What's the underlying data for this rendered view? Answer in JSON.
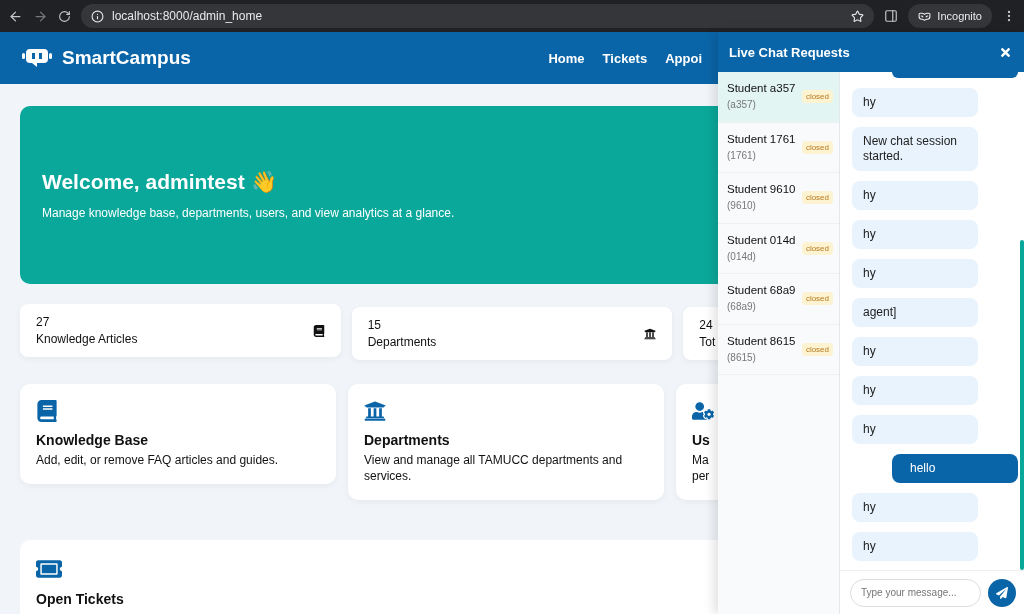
{
  "browser": {
    "url": "localhost:8000/admin_home",
    "profile": "Incognito"
  },
  "header": {
    "brand": "SmartCampus",
    "nav": [
      {
        "label": "Home"
      },
      {
        "label": "Tickets"
      },
      {
        "label": "Appoi"
      }
    ]
  },
  "hero": {
    "title": "Welcome, admintest 👋",
    "subtitle": "Manage knowledge base, departments, users, and view analytics at a glance."
  },
  "stats": [
    {
      "kind": "book",
      "value": "27",
      "label": "Knowledge Articles"
    },
    {
      "kind": "building",
      "value": "15",
      "label": "Departments"
    },
    {
      "kind": "hidden",
      "value": "24",
      "label": "Tot"
    }
  ],
  "features": [
    {
      "kind": "book",
      "title": "Knowledge Base",
      "description": "Add, edit, or remove FAQ articles and guides."
    },
    {
      "kind": "building",
      "title": "Departments",
      "description": "View and manage all TAMUCC departments and services."
    },
    {
      "kind": "user",
      "title": "Us",
      "description": "Ma\nper"
    }
  ],
  "tickets_card": {
    "title": "Open Tickets"
  },
  "chat": {
    "title": "Live Chat Requests",
    "requests": [
      {
        "name": "Student a357",
        "id": "(a357)",
        "status": "closed",
        "selected": true
      },
      {
        "name": "Student 1761",
        "id": "(1761)",
        "status": "closed",
        "selected": false
      },
      {
        "name": "Student 9610",
        "id": "(9610)",
        "status": "closed",
        "selected": false
      },
      {
        "name": "Student 014d",
        "id": "(014d)",
        "status": "closed",
        "selected": false
      },
      {
        "name": "Student 68a9",
        "id": "(68a9)",
        "status": "closed",
        "selected": false
      },
      {
        "name": "Student 8615",
        "id": "(8615)",
        "status": "closed",
        "selected": false
      }
    ],
    "messages": [
      {
        "kind": "received",
        "text": "hy"
      },
      {
        "kind": "received",
        "text": "New chat session started."
      },
      {
        "kind": "received",
        "text": "hy"
      },
      {
        "kind": "received",
        "text": "hy"
      },
      {
        "kind": "received",
        "text": "hy"
      },
      {
        "kind": "received",
        "text": "agent]"
      },
      {
        "kind": "received",
        "text": "hy"
      },
      {
        "kind": "received",
        "text": "hy"
      },
      {
        "kind": "received",
        "text": "hy"
      },
      {
        "kind": "sent",
        "text": "hello"
      },
      {
        "kind": "received",
        "text": "hy"
      },
      {
        "kind": "received",
        "text": "hy"
      }
    ],
    "input": {
      "placeholder": "Type your message..."
    }
  }
}
